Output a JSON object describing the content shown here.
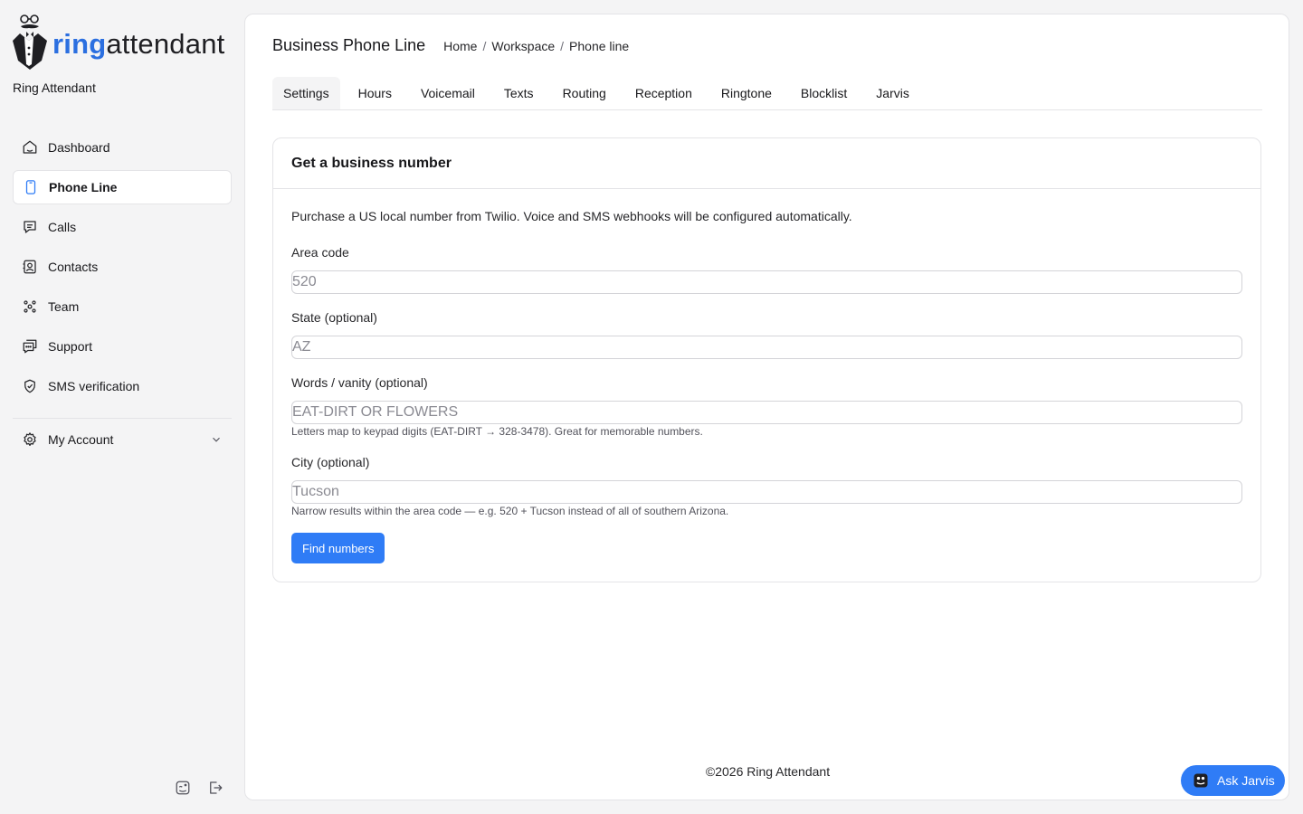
{
  "brand": {
    "logo_ring": "ring",
    "logo_attendant": "attendant",
    "name": "Ring Attendant",
    "accent": "#2f7cf6"
  },
  "sidebar": {
    "items": [
      {
        "label": "Dashboard",
        "icon": "home-icon"
      },
      {
        "label": "Phone Line",
        "icon": "phone-device-icon",
        "active": true
      },
      {
        "label": "Calls",
        "icon": "message-icon"
      },
      {
        "label": "Contacts",
        "icon": "contact-card-icon"
      },
      {
        "label": "Team",
        "icon": "team-icon"
      },
      {
        "label": "Support",
        "icon": "chat-bubble-icon"
      },
      {
        "label": "SMS verification",
        "icon": "shield-check-icon"
      }
    ],
    "account_label": "My Account"
  },
  "header": {
    "title": "Business Phone Line",
    "breadcrumb": [
      "Home",
      "Workspace",
      "Phone line"
    ]
  },
  "tabs": [
    "Settings",
    "Hours",
    "Voicemail",
    "Texts",
    "Routing",
    "Reception",
    "Ringtone",
    "Blocklist",
    "Jarvis"
  ],
  "card": {
    "title": "Get a business number",
    "description": "Purchase a US local number from Twilio. Voice and SMS webhooks will be configured automatically.",
    "fields": {
      "area_code": {
        "label": "Area code",
        "placeholder": "520",
        "value": ""
      },
      "state": {
        "label": "State (optional)",
        "placeholder": "AZ",
        "value": ""
      },
      "vanity": {
        "label": "Words / vanity (optional)",
        "placeholder": "EAT-DIRT OR FLOWERS",
        "value": "",
        "hint": "Letters map to keypad digits (EAT-DIRT → 328-3478). Great for memorable numbers."
      },
      "city": {
        "label": "City (optional)",
        "placeholder": "Tucson",
        "value": "",
        "hint": "Narrow results within the area code — e.g. 520 + Tucson instead of all of southern Arizona."
      }
    },
    "submit_label": "Find numbers"
  },
  "footer": {
    "copyright": "©2026 Ring Attendant"
  },
  "ask_jarvis": {
    "label": "Ask Jarvis"
  }
}
